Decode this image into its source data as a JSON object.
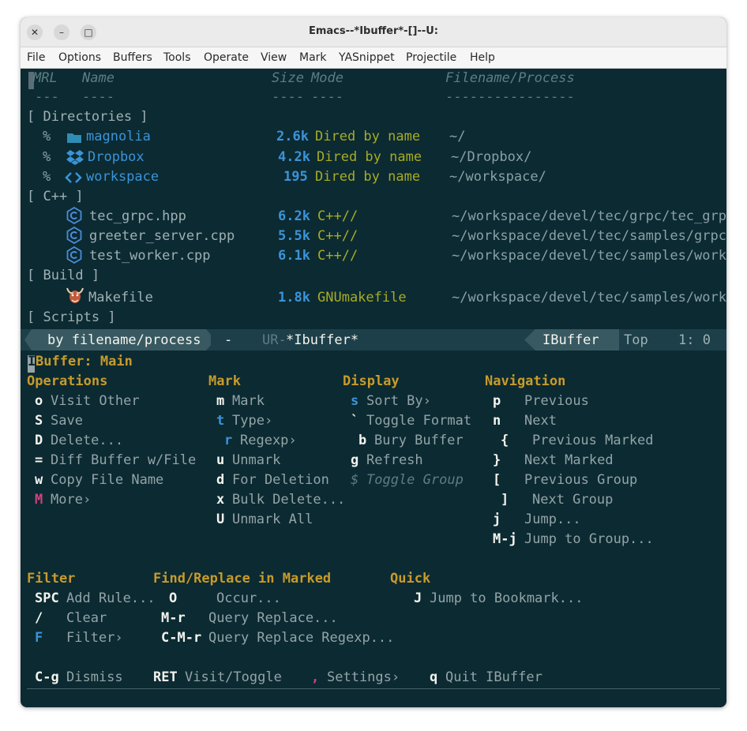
{
  "window": {
    "title": "Emacs--*Ibuffer*-[]--U:",
    "close": "✕",
    "minimize": "–",
    "maximize": "□"
  },
  "menubar": [
    "File",
    "Options",
    "Buffers",
    "Tools",
    "Operate",
    "View",
    "Mark",
    "YASnippet",
    "Projectile",
    "Help"
  ],
  "ibuffer": {
    "headers": {
      "mrl": "MRL",
      "name": "Name",
      "size": "Size",
      "mode": "Mode",
      "filename": "Filename/Process"
    },
    "header_rules": {
      "mrl": "---",
      "name": "----",
      "size": "----",
      "mode": "----",
      "filename": "----------------"
    },
    "groups": [
      {
        "title": "[ Directories ]",
        "rows": [
          {
            "mark": "%",
            "name": "magnolia",
            "size": "2.6k",
            "mode": "Dired by name",
            "filename": "~/",
            "icon": "folder-icon"
          },
          {
            "mark": "%",
            "name": "Dropbox",
            "size": "4.2k",
            "mode": "Dired by name",
            "filename": "~/Dropbox/",
            "icon": "dropbox-icon"
          },
          {
            "mark": "%",
            "name": "workspace",
            "size": "195",
            "mode": "Dired by name",
            "filename": "~/workspace/",
            "icon": "code-icon"
          }
        ]
      },
      {
        "title": "[ C++ ]",
        "rows": [
          {
            "mark": "",
            "name": "tec_grpc.hpp",
            "size": "6.2k",
            "mode": "C++//",
            "filename": "~/workspace/devel/tec/grpc/tec_grp▸",
            "icon": "cpp-icon"
          },
          {
            "mark": "",
            "name": "greeter_server.cpp",
            "size": "5.5k",
            "mode": "C++//",
            "filename": "~/workspace/devel/tec/samples/grpc▸",
            "icon": "cpp-icon"
          },
          {
            "mark": "",
            "name": "test_worker.cpp",
            "size": "6.1k",
            "mode": "C++//",
            "filename": "~/workspace/devel/tec/samples/work▸",
            "icon": "cpp-icon"
          }
        ]
      },
      {
        "title": "[ Build ]",
        "rows": [
          {
            "mark": "",
            "name": "Makefile",
            "size": "1.8k",
            "mode": "GNUmakefile",
            "filename": "~/workspace/devel/tec/samples/work▸",
            "icon": "gnu-icon"
          }
        ]
      },
      {
        "title": "[ Scripts ]",
        "rows": []
      }
    ]
  },
  "modeline": {
    "grouping": "by filename/process",
    "dash": "-",
    "state": "UR-",
    "buffer": "*Ibuffer*",
    "major_mode": "IBuffer",
    "position": "Top",
    "line_col": "1: 0"
  },
  "hint": {
    "title_key": "I",
    "title": "Buffer: Main",
    "operations": {
      "heading": "Operations",
      "items": [
        {
          "key": "o",
          "label": "Visit Other"
        },
        {
          "key": "S",
          "label": "Save"
        },
        {
          "key": "D",
          "label": "Delete..."
        },
        {
          "key": "=",
          "label": "Diff Buffer w/File"
        },
        {
          "key": "w",
          "label": "Copy File Name"
        },
        {
          "key": "M",
          "label": "More›"
        }
      ]
    },
    "mark": {
      "heading": "Mark",
      "items": [
        {
          "key": "m",
          "label": "Mark"
        },
        {
          "key": "t",
          "label": "Type›"
        },
        {
          "key": "r",
          "label": "Regexp›"
        },
        {
          "key": "u",
          "label": "Unmark"
        },
        {
          "key": "d",
          "label": "For Deletion"
        },
        {
          "key": "x",
          "label": "Bulk Delete..."
        },
        {
          "key": "U",
          "label": "Unmark All"
        }
      ]
    },
    "display": {
      "heading": "Display",
      "items": [
        {
          "key": "s",
          "label": "Sort By›"
        },
        {
          "key": "`",
          "label": "Toggle Format"
        },
        {
          "key": "b",
          "label": "Bury Buffer"
        },
        {
          "key": "g",
          "label": "Refresh"
        },
        {
          "key": "$",
          "label": "Toggle Group"
        }
      ]
    },
    "navigation": {
      "heading": "Navigation",
      "items": [
        {
          "key": "p",
          "label": "Previous"
        },
        {
          "key": "n",
          "label": "Next"
        },
        {
          "key": "{",
          "label": "Previous Marked"
        },
        {
          "key": "}",
          "label": "Next Marked"
        },
        {
          "key": "[",
          "label": "Previous Group"
        },
        {
          "key": "]",
          "label": "Next Group"
        },
        {
          "key": "j",
          "label": "Jump..."
        },
        {
          "key": "M-j",
          "label": "Jump to Group..."
        }
      ]
    },
    "filter": {
      "heading": "Filter",
      "items": [
        {
          "key": "SPC",
          "label": "Add Rule..."
        },
        {
          "key": "/",
          "label": "Clear"
        },
        {
          "key": "F",
          "label": "Filter›"
        }
      ]
    },
    "findreplace": {
      "heading": "Find/Replace in Marked",
      "items": [
        {
          "key": "O",
          "label": "Occur..."
        },
        {
          "key": "M-r",
          "label": "Query Replace..."
        },
        {
          "key": "C-M-r",
          "label": "Query Replace Regexp..."
        }
      ]
    },
    "quick": {
      "heading": "Quick",
      "items": [
        {
          "key": "J",
          "label": "Jump to Bookmark..."
        }
      ]
    },
    "footer": [
      {
        "key": "C-g",
        "label": "Dismiss"
      },
      {
        "key": "RET",
        "label": "Visit/Toggle"
      },
      {
        "key": ",",
        "label": "Settings›"
      },
      {
        "key": "q",
        "label": "Quit IBuffer"
      }
    ]
  },
  "colors": {
    "background": "#0c2a32",
    "modeline": "#1d3f49",
    "accent_blue": "#3a94d8",
    "mode_green": "#a6ac24",
    "heading_gold": "#c89b2a",
    "key_pink": "#d0437e"
  }
}
